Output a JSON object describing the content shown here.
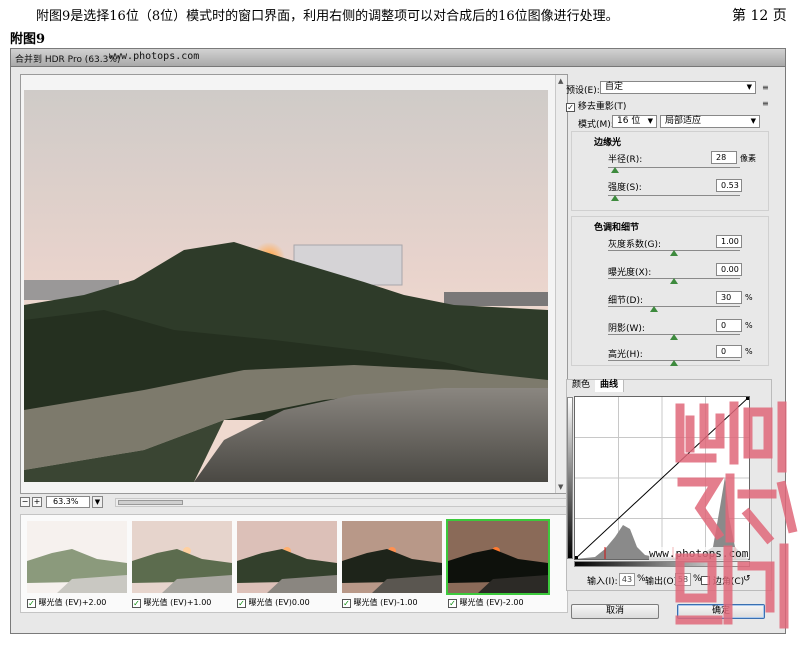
{
  "document": {
    "paragraph": "附图9是选择16位（8位）模式时的窗口界面，利用右侧的调整项可以对合成后的16位图像进行处理。",
    "page_number": "第 12 页",
    "figure_label": "附图9"
  },
  "window": {
    "title": "合并到 HDR Pro (63.3%)",
    "title_watermark": "www.photops.com"
  },
  "preview": {
    "zoom": "63.3%",
    "zoom_out": "−",
    "zoom_in": "+"
  },
  "filmstrip": [
    {
      "label": "曝光值 (EV)+2.00",
      "checked": true,
      "selected": false
    },
    {
      "label": "曝光值 (EV)+1.00",
      "checked": true,
      "selected": false
    },
    {
      "label": "曝光值 (EV)0.00",
      "checked": true,
      "selected": false
    },
    {
      "label": "曝光值 (EV)-1.00",
      "checked": true,
      "selected": false
    },
    {
      "label": "曝光值 (EV)-2.00",
      "checked": true,
      "selected": true
    }
  ],
  "right_panel": {
    "preset_label": "预设(E):",
    "preset_value": "自定",
    "remove_ghosts_label": "移去重影(T)",
    "remove_ghosts_checked": true,
    "mode_label": "模式(M):",
    "mode_value": "16 位",
    "method_value": "局部适应",
    "edge_glow": {
      "title": "边缘光",
      "radius_label": "半径(R):",
      "radius_value": "28",
      "radius_unit": "像素",
      "radius_fraction": 0.05,
      "strength_label": "强度(S):",
      "strength_value": "0.53",
      "strength_fraction": 0.05
    },
    "tone_detail": {
      "title": "色调和细节",
      "gamma_label": "灰度系数(G):",
      "gamma_value": "1.00",
      "gamma_fraction": 0.5,
      "exposure_label": "曝光度(X):",
      "exposure_value": "0.00",
      "exposure_fraction": 0.5,
      "detail_label": "细节(D):",
      "detail_value": "30",
      "detail_fraction": 0.35,
      "shadow_label": "阴影(W):",
      "shadow_value": "0",
      "shadow_fraction": 0.5,
      "highlight_label": "高光(H):",
      "highlight_value": "0",
      "highlight_fraction": 0.5,
      "percent": "%"
    },
    "tabs": {
      "color": "颜色",
      "curve": "曲线"
    },
    "curve": {
      "input_label": "输入(I):",
      "input_value": "43",
      "output_label": "输出(O):",
      "output_value": "58",
      "percent": "%",
      "corner_label": "边角(C)"
    }
  },
  "buttons": {
    "cancel": "取消",
    "ok": "确定"
  },
  "watermark": "www.photops.com",
  "colors": {
    "selection": "#3cc93c",
    "seal": "#e0687a"
  }
}
